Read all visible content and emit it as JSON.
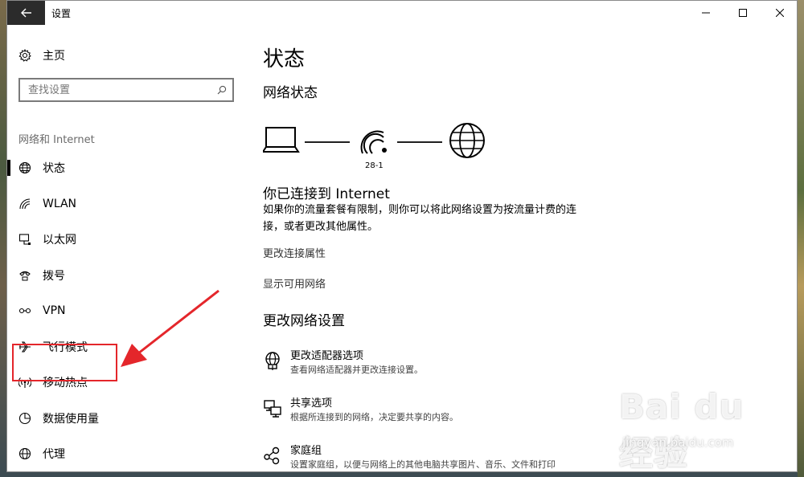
{
  "window": {
    "title": "设置"
  },
  "sidebar": {
    "home_label": "主页",
    "search_placeholder": "查找设置",
    "section_label": "网络和 Internet",
    "items": [
      {
        "label": "状态",
        "icon": "globe-status-icon",
        "selected": true
      },
      {
        "label": "WLAN",
        "icon": "wifi-icon"
      },
      {
        "label": "以太网",
        "icon": "ethernet-icon"
      },
      {
        "label": "拨号",
        "icon": "dialup-icon"
      },
      {
        "label": "VPN",
        "icon": "vpn-icon"
      },
      {
        "label": "飞行模式",
        "icon": "airplane-icon"
      },
      {
        "label": "移动热点",
        "icon": "hotspot-icon"
      },
      {
        "label": "数据使用量",
        "icon": "data-usage-icon"
      },
      {
        "label": "代理",
        "icon": "proxy-globe-icon"
      }
    ]
  },
  "main": {
    "title": "状态",
    "network_status_title": "网络状态",
    "network_name": "28-1",
    "connected_title": "你已连接到 Internet",
    "connected_desc": "如果你的流量套餐有限制，则你可以将此网络设置为按流量计费的连接，或者更改其他属性。",
    "links": {
      "change_properties": "更改连接属性",
      "show_networks": "显示可用网络"
    },
    "change_settings_title": "更改网络设置",
    "options": [
      {
        "title": "更改适配器选项",
        "desc": "查看网络适配器并更改连接设置。",
        "icon": "adapter-icon"
      },
      {
        "title": "共享选项",
        "desc": "根据所连接到的网络，决定要共享的内容。",
        "icon": "sharing-icon"
      },
      {
        "title": "家庭组",
        "desc": "设置家庭组，以便与网络上的其他电脑共享图片、音乐、文件和打印",
        "icon": "homegroup-icon"
      }
    ]
  },
  "annotation": {
    "highlight_color": "#e4262b"
  },
  "watermark": {
    "logo": "Bai du 经验",
    "url": "jingyan.baidu.com"
  }
}
